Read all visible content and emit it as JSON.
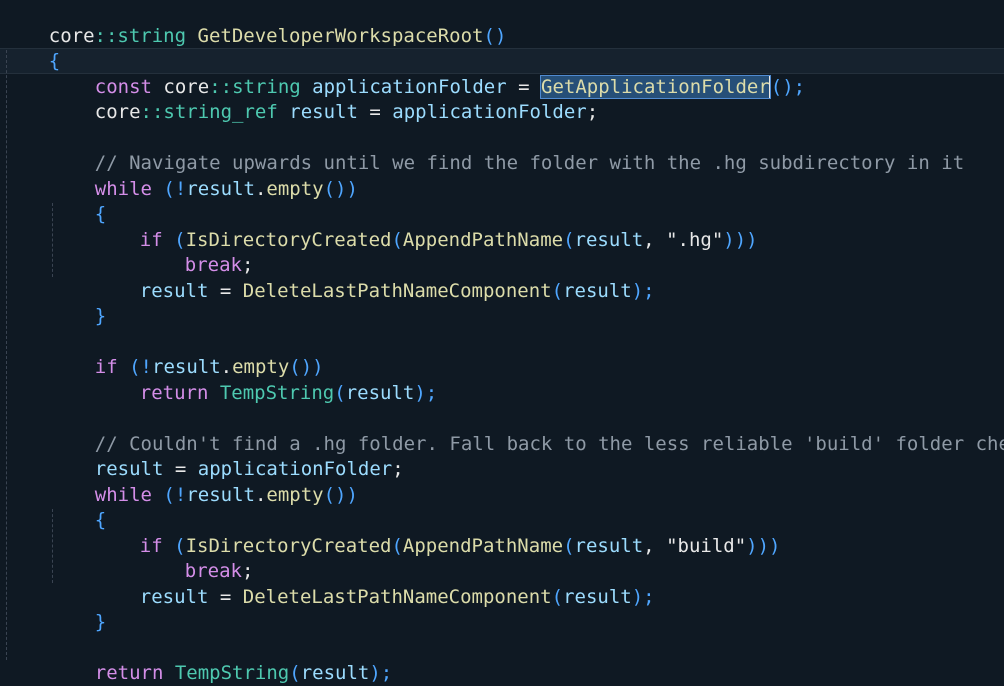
{
  "editor": {
    "lines": [
      [
        "core",
        "::",
        "string",
        " ",
        "GetDeveloperWorkspaceRoot",
        "()"
      ],
      [
        "{"
      ],
      [
        "const",
        "core",
        "::",
        "string",
        "applicationFolder",
        "=",
        "GetApplicationFolder",
        "();"
      ],
      [
        "core",
        "::",
        "string_ref",
        "result",
        "=",
        "applicationFolder",
        ";"
      ],
      [
        ""
      ],
      [
        "// Navigate upwards until we find the folder with the .hg subdirectory in it"
      ],
      [
        "while",
        "(!",
        "result",
        ".",
        "empty",
        "())"
      ],
      [
        "{"
      ],
      [
        "if",
        "(",
        "IsDirectoryCreated",
        "(",
        "AppendPathName",
        "(",
        "result",
        ", ",
        "\".hg\"",
        ")))"
      ],
      [
        "break",
        ";"
      ],
      [
        "result",
        "=",
        "DeleteLastPathNameComponent",
        "(",
        "result",
        ");"
      ],
      [
        "}"
      ],
      [
        ""
      ],
      [
        "if",
        "(!",
        "result",
        ".",
        "empty",
        "())"
      ],
      [
        "return",
        "TempString",
        "(",
        "result",
        ");"
      ],
      [
        ""
      ],
      [
        "// Couldn't find a .hg folder. Fall back to the less reliable 'build' folder check."
      ],
      [
        "result",
        "=",
        "applicationFolder",
        ";"
      ],
      [
        "while",
        "(!",
        "result",
        ".",
        "empty",
        "())"
      ],
      [
        "{"
      ],
      [
        "if",
        "(",
        "IsDirectoryCreated",
        "(",
        "AppendPathName",
        "(",
        "result",
        ", ",
        "\"build\"",
        ")))"
      ],
      [
        "break",
        ";"
      ],
      [
        "result",
        "=",
        "DeleteLastPathNameComponent",
        "(",
        "result",
        ");"
      ],
      [
        "}"
      ],
      [
        ""
      ],
      [
        "return",
        "TempString",
        "(",
        "result",
        ");"
      ],
      [
        "}"
      ]
    ]
  },
  "colors": {
    "background": "#0f1923",
    "keyword": "#d48ee8",
    "type": "#4ec9b0",
    "function": "#dcdcaa",
    "comment": "#8f9aa6",
    "bracket": "#4fa6ff",
    "selection": "#264f78"
  }
}
